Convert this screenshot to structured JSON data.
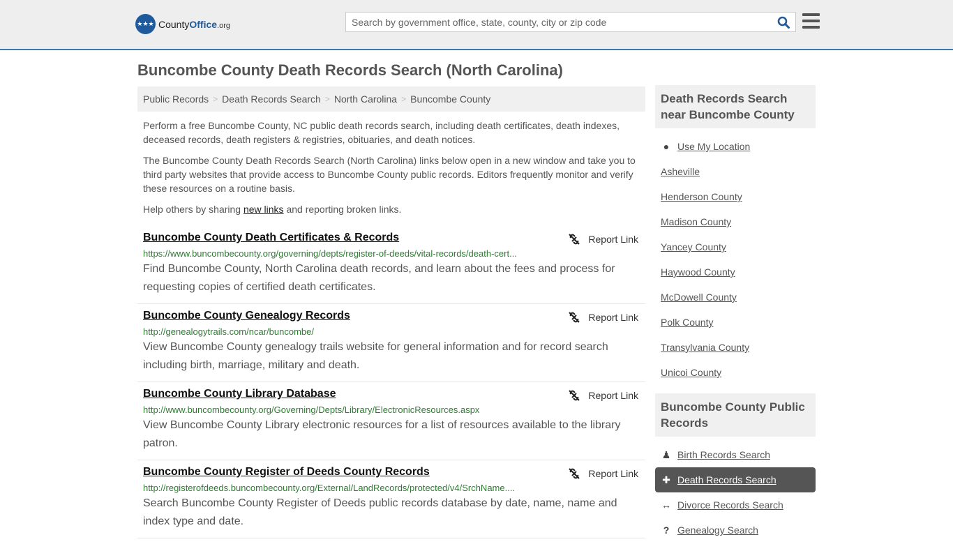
{
  "header": {
    "logo": {
      "county": "County",
      "office": "Office",
      "org": ".org"
    },
    "search_placeholder": "Search by government office, state, county, city or zip code"
  },
  "page_title": "Buncombe County Death Records Search (North Carolina)",
  "breadcrumb": [
    "Public Records",
    "Death Records Search",
    "North Carolina",
    "Buncombe County"
  ],
  "intro": {
    "p1": "Perform a free Buncombe County, NC public death records search, including death certificates, death indexes, deceased records, death registers & registries, obituaries, and death notices.",
    "p2": "The Buncombe County Death Records Search (North Carolina) links below open in a new window and take you to third party websites that provide access to Buncombe County public records. Editors frequently monitor and verify these resources on a routine basis.",
    "p3_before": "Help others by sharing ",
    "p3_link": "new links",
    "p3_after": " and reporting broken links."
  },
  "report_label": "Report Link",
  "results": [
    {
      "title": "Buncombe County Death Certificates & Records",
      "url": "https://www.buncombecounty.org/governing/depts/register-of-deeds/vital-records/death-cert...",
      "desc": "Find Buncombe County, North Carolina death records, and learn about the fees and process for requesting copies of certified death certificates."
    },
    {
      "title": "Buncombe County Genealogy Records",
      "url": "http://genealogytrails.com/ncar/buncombe/",
      "desc": "View Buncombe County genealogy trails website for general information and for record search including birth, marriage, military and death."
    },
    {
      "title": "Buncombe County Library Database",
      "url": "http://www.buncombecounty.org/Governing/Depts/Library/ElectronicResources.aspx",
      "desc": "View Buncombe County Library electronic resources for a list of resources available to the library patron."
    },
    {
      "title": "Buncombe County Register of Deeds County Records",
      "url": "http://registerofdeeds.buncombecounty.org/External/LandRecords/protected/v4/SrchName....",
      "desc": "Search Buncombe County Register of Deeds public records database by date, name, name and index type and date."
    }
  ],
  "sidebar": {
    "nearby_title": "Death Records Search near Buncombe County",
    "use_location": "Use My Location",
    "nearby": [
      "Asheville",
      "Henderson County",
      "Madison County",
      "Yancey County",
      "Haywood County",
      "McDowell County",
      "Polk County",
      "Transylvania County",
      "Unicoi County"
    ],
    "public_title": "Buncombe County Public Records",
    "public_items": [
      {
        "icon": "child-icon",
        "glyph": "♟",
        "label": "Birth Records Search",
        "active": false
      },
      {
        "icon": "plus-icon",
        "glyph": "✚",
        "label": "Death Records Search",
        "active": true
      },
      {
        "icon": "arrows-h-icon",
        "glyph": "↔",
        "label": "Divorce Records Search",
        "active": false
      },
      {
        "icon": "question-icon",
        "glyph": "?",
        "label": "Genealogy Search",
        "active": false
      }
    ]
  }
}
